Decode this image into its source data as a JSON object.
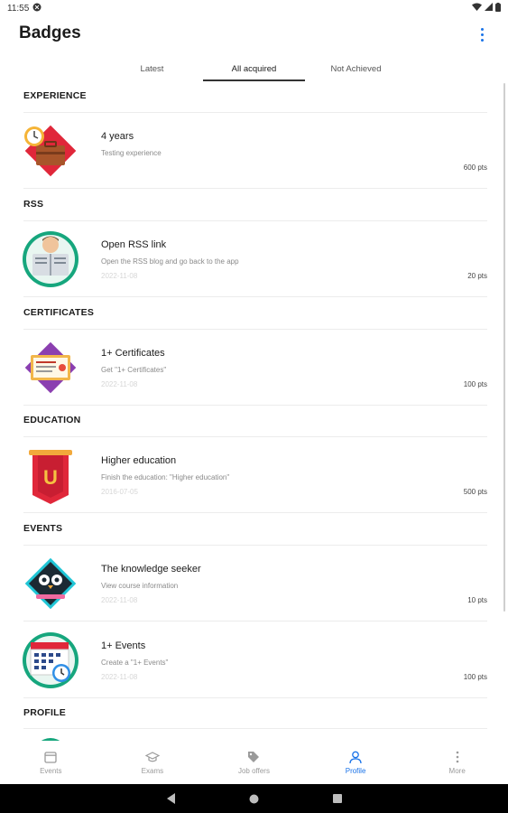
{
  "status_bar": {
    "time": "11:55"
  },
  "header": {
    "title": "Badges"
  },
  "tabs": [
    {
      "label": "Latest"
    },
    {
      "label": "All acquired"
    },
    {
      "label": "Not Achieved"
    }
  ],
  "sections": {
    "experience": "EXPERIENCE",
    "rss": "RSS",
    "certificates": "CERTIFICATES",
    "education": "EDUCATION",
    "events": "EVENTS",
    "profile": "PROFILE"
  },
  "badges": [
    {
      "name": "4 years",
      "description": "Testing experience",
      "date": "",
      "points": "600 pts",
      "icon": "briefcase-clock-icon"
    },
    {
      "name": "Open RSS link",
      "description": "Open the RSS blog and go back to the app",
      "date": "2022-11-08",
      "points": "20 pts",
      "icon": "newspaper-reader-icon"
    },
    {
      "name": "1+ Certificates",
      "description": "Get \"1+ Certificates\"",
      "date": "2022-11-08",
      "points": "100 pts",
      "icon": "certificate-icon"
    },
    {
      "name": "Higher education",
      "description": "Finish the education: \"Higher education\"",
      "date": "2016-07-05",
      "points": "500 pts",
      "icon": "university-banner-icon"
    },
    {
      "name": "The knowledge seeker",
      "description": "View course information",
      "date": "2022-11-08",
      "points": "10 pts",
      "icon": "owl-icon"
    },
    {
      "name": "1+ Events",
      "description": "Create a \"1+ Events\"",
      "date": "2022-11-08",
      "points": "100 pts",
      "icon": "calendar-clock-icon"
    }
  ],
  "bottom_nav": [
    {
      "label": "Events",
      "icon": "calendar-icon"
    },
    {
      "label": "Exams",
      "icon": "graduation-cap-icon"
    },
    {
      "label": "Job offers",
      "icon": "tag-icon"
    },
    {
      "label": "Profile",
      "icon": "person-icon"
    },
    {
      "label": "More",
      "icon": "more-vert-icon"
    }
  ],
  "colors": {
    "accent": "#1a73e8",
    "active_tab_indicator": "#333333"
  }
}
